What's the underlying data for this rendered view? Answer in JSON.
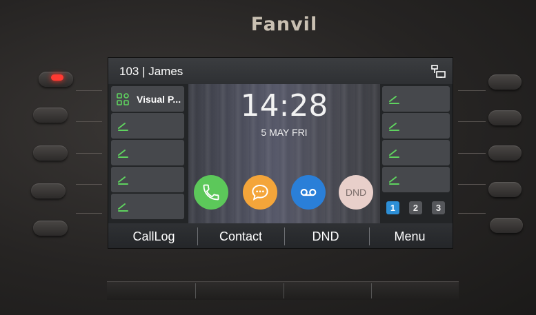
{
  "device": {
    "brand": "Fanvil"
  },
  "status_bar": {
    "account": "103 | James",
    "network_icon": "network-icon"
  },
  "idle": {
    "time": "14:28",
    "date": "5 MAY FRI"
  },
  "left_keys": [
    {
      "label": "Visual P...",
      "icon": "grid-apps-icon"
    },
    {
      "label": "",
      "icon": "line-key-icon"
    },
    {
      "label": "",
      "icon": "line-key-icon"
    },
    {
      "label": "",
      "icon": "line-key-icon"
    },
    {
      "label": "",
      "icon": "line-key-icon"
    }
  ],
  "right_keys": [
    {
      "label": "",
      "icon": "line-key-icon"
    },
    {
      "label": "",
      "icon": "line-key-icon"
    },
    {
      "label": "",
      "icon": "line-key-icon"
    },
    {
      "label": "",
      "icon": "line-key-icon"
    }
  ],
  "apps": [
    {
      "name": "phone",
      "icon": "phone-icon",
      "color": "#5cc85a"
    },
    {
      "name": "messages",
      "icon": "message-icon",
      "color": "#f4a53a"
    },
    {
      "name": "voicemail",
      "icon": "voicemail-icon",
      "color": "#2a7fd8"
    },
    {
      "name": "dnd",
      "label": "DND",
      "color": "#e8cfca"
    }
  ],
  "pages": [
    "1",
    "2",
    "3"
  ],
  "active_page": "1",
  "softkeys": [
    "CallLog",
    "Contact",
    "DND",
    "Menu"
  ],
  "colors": {
    "accent": "#2d8fd6",
    "line_key_icon": "#5fd35f",
    "led": "#ff3a32"
  }
}
